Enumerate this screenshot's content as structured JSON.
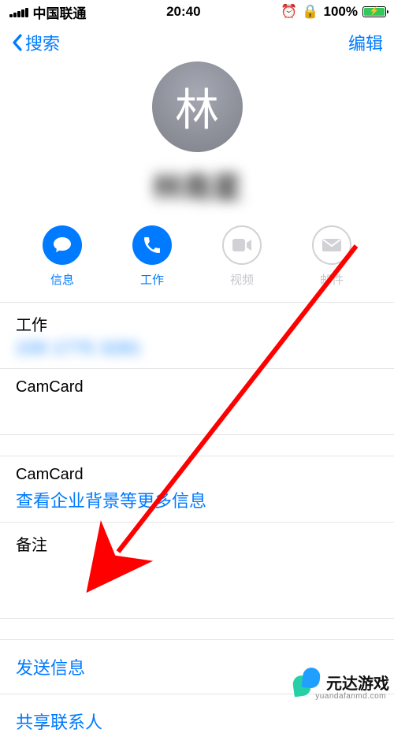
{
  "status": {
    "carrier": "中国联通",
    "time": "20:40",
    "battery_pct": "100%"
  },
  "nav": {
    "back": "搜索",
    "edit": "编辑"
  },
  "contact": {
    "avatar_initial": "林",
    "name": "林南星"
  },
  "actions": {
    "message": "信息",
    "call": "工作",
    "video": "视频",
    "mail": "邮件"
  },
  "phone": {
    "label": "工作",
    "number": "159 1775 3281"
  },
  "camcard1": {
    "label": "CamCard"
  },
  "camcard2": {
    "label": "CamCard",
    "link": "查看企业背景等更多信息"
  },
  "notes": {
    "label": "备注"
  },
  "rows": {
    "send_message": "发送信息",
    "share_contact": "共享联系人"
  },
  "watermark": {
    "text": "元达游戏",
    "url": "yuandafanmd.com"
  },
  "colors": {
    "accent": "#007aff",
    "disabled": "#c7c7cc",
    "arrow": "#ff0000"
  }
}
